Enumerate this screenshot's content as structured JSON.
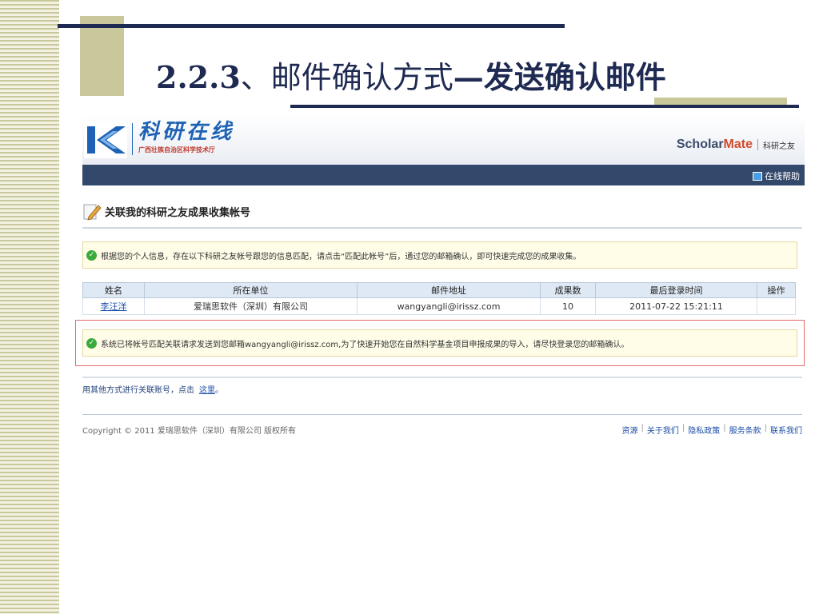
{
  "slide": {
    "title_num": "2.2.3",
    "title_mid": "、邮件确认方式",
    "title_rest": "—发送确认邮件"
  },
  "site": {
    "logo_cn": "科研在线",
    "logo_sub": "广西壮族自治区科学技术厅",
    "brand_sch": "Sch",
    "brand_o": "o",
    "brand_lar": "lar",
    "brand_mate": "Mate",
    "brand_cn": "科研之友",
    "help": "在线帮助"
  },
  "section": {
    "title": "关联我的科研之友成果收集帐号"
  },
  "notice1": "根据您的个人信息，存在以下科研之友帐号跟您的信息匹配，请点击“匹配此帐号”后，通过您的邮箱确认，即可快速完成您的成果收集。",
  "table": {
    "headers": [
      "姓名",
      "所在单位",
      "邮件地址",
      "成果数",
      "最后登录时间",
      "操作"
    ],
    "rows": [
      [
        "李汪洋",
        "爱瑞思软件（深圳）有限公司",
        "wangyangli@irissz.com",
        "10",
        "2011-07-22 15:21:11",
        ""
      ]
    ]
  },
  "notice2": "系统已将帐号匹配关联请求发送到您邮箱wangyangli@irissz.com,为了快速开始您在自然科学基金项目申报成果的导入，请尽快登录您的邮箱确认。",
  "other": {
    "text": "用其他方式进行关联账号，点击",
    "link": "这里",
    "end": "。"
  },
  "footer": {
    "copyright": "Copyright © 2011 爱瑞思软件（深圳）有限公司 版权所有",
    "links": [
      "资源",
      "关于我们",
      "隐私政策",
      "服务条款",
      "联系我们"
    ]
  },
  "colors": {
    "accent": "#1f2a52",
    "tan": "#c9c89a",
    "nav": "#33496b",
    "highlight_border": "#e36a6a"
  }
}
